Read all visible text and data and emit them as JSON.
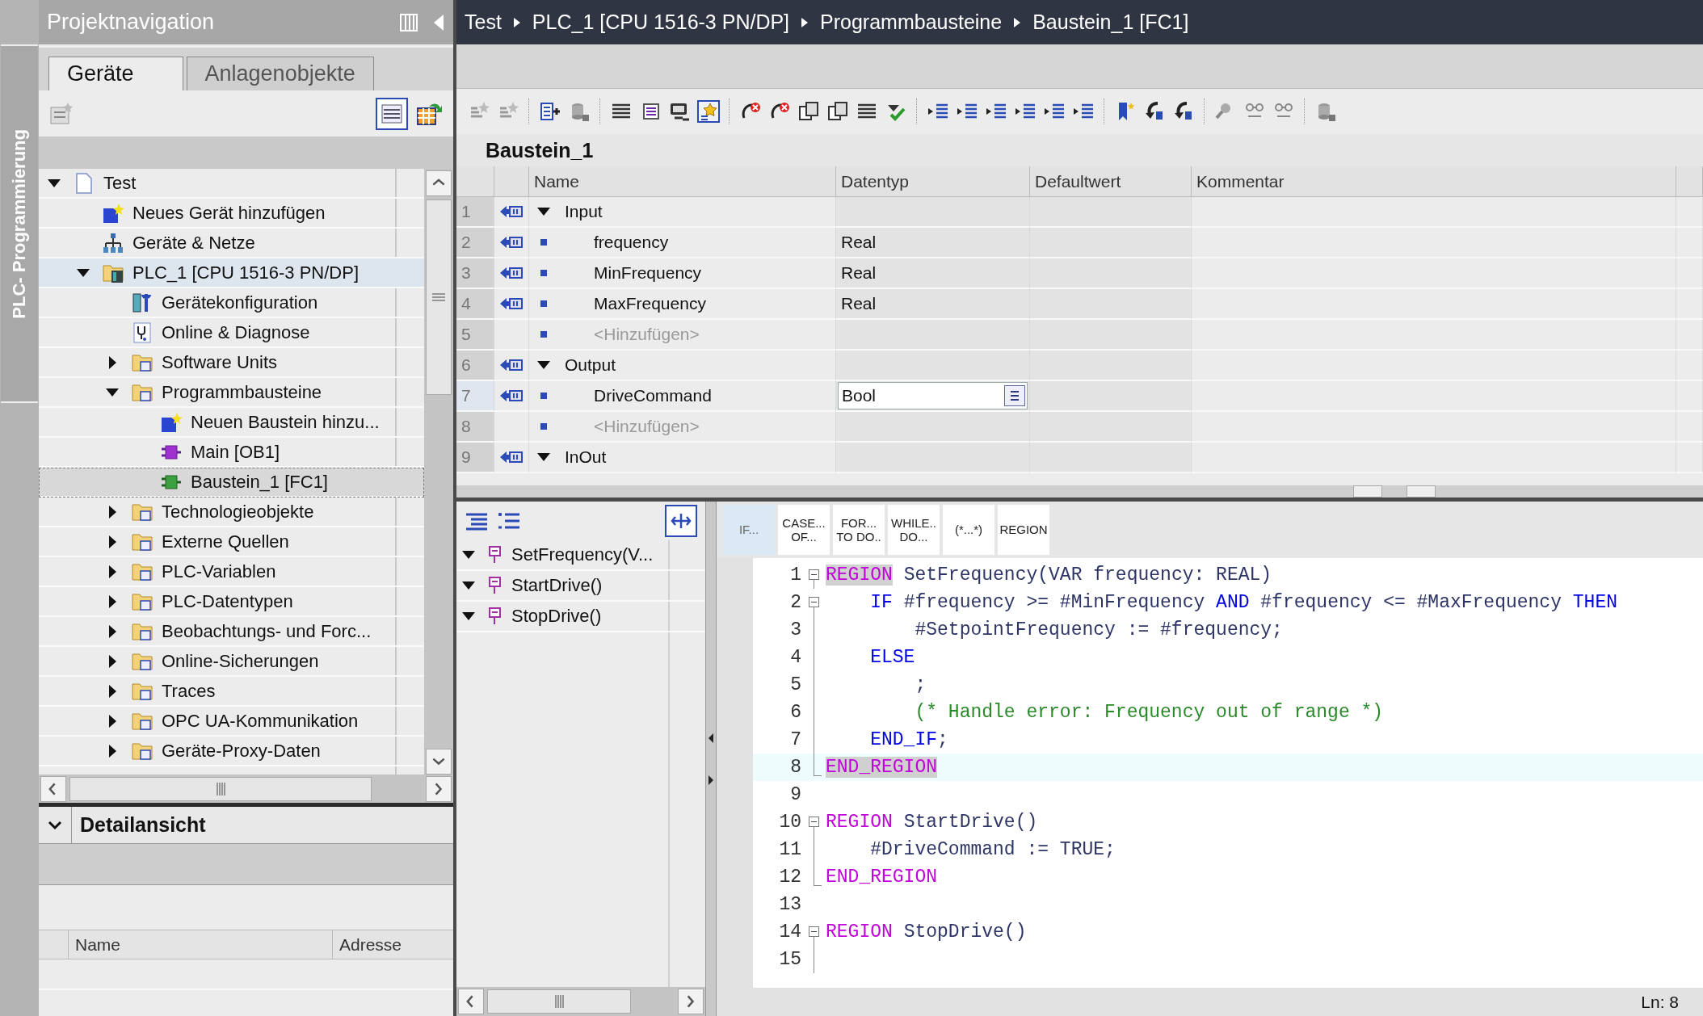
{
  "side_tab": {
    "label": "PLC- Programmierung"
  },
  "project_navigation": {
    "title": "Projektnavigation",
    "tabs": [
      {
        "label": "Geräte",
        "selected": true
      },
      {
        "label": "Anlagenobjekte",
        "selected": false
      }
    ],
    "tree": [
      {
        "label": "Test",
        "kind": "project",
        "expanded": true,
        "selected": false,
        "highlighted": false,
        "children": [
          {
            "label": "Neues Gerät hinzufügen",
            "kind": "add",
            "selected": false,
            "highlighted": false
          },
          {
            "label": "Geräte & Netze",
            "kind": "network",
            "selected": false,
            "highlighted": false
          },
          {
            "label": "PLC_1 [CPU 1516-3 PN/DP]",
            "kind": "plc",
            "expanded": true,
            "selected": false,
            "highlighted": true,
            "children": [
              {
                "label": "Gerätekonfiguration",
                "kind": "config",
                "selected": false,
                "highlighted": false
              },
              {
                "label": "Online & Diagnose",
                "kind": "diagnose",
                "selected": false,
                "highlighted": false
              },
              {
                "label": "Software Units",
                "kind": "folder",
                "expanded": false,
                "selected": false,
                "highlighted": false
              },
              {
                "label": "Programmbausteine",
                "kind": "folder",
                "expanded": true,
                "selected": false,
                "highlighted": false,
                "children": [
                  {
                    "label": "Neuen Baustein hinzu...",
                    "kind": "add",
                    "selected": false,
                    "highlighted": false
                  },
                  {
                    "label": "Main [OB1]",
                    "kind": "block-ob",
                    "selected": false,
                    "highlighted": false
                  },
                  {
                    "label": "Baustein_1 [FC1]",
                    "kind": "block-fc",
                    "selected": true,
                    "highlighted": false
                  }
                ]
              },
              {
                "label": "Technologieobjekte",
                "kind": "folder",
                "expanded": false,
                "selected": false,
                "highlighted": false
              },
              {
                "label": "Externe Quellen",
                "kind": "folder",
                "expanded": false,
                "selected": false,
                "highlighted": false
              },
              {
                "label": "PLC-Variablen",
                "kind": "folder",
                "expanded": false,
                "selected": false,
                "highlighted": false
              },
              {
                "label": "PLC-Datentypen",
                "kind": "folder",
                "expanded": false,
                "selected": false,
                "highlighted": false
              },
              {
                "label": "Beobachtungs- und Forc...",
                "kind": "folder",
                "expanded": false,
                "selected": false,
                "highlighted": false
              },
              {
                "label": "Online-Sicherungen",
                "kind": "folder",
                "expanded": false,
                "selected": false,
                "highlighted": false
              },
              {
                "label": "Traces",
                "kind": "folder",
                "expanded": false,
                "selected": false,
                "highlighted": false
              },
              {
                "label": "OPC UA-Kommunikation",
                "kind": "folder",
                "expanded": false,
                "selected": false,
                "highlighted": false
              },
              {
                "label": "Geräte-Proxy-Daten",
                "kind": "folder",
                "expanded": false,
                "selected": false,
                "highlighted": false
              }
            ]
          }
        ]
      }
    ]
  },
  "detail_view": {
    "title": "Detailansicht",
    "expanded": true,
    "columns": [
      "Name",
      "Adresse"
    ]
  },
  "breadcrumb": [
    "Test",
    "PLC_1 [CPU 1516-3 PN/DP]",
    "Programmbausteine",
    "Baustein_1 [FC1]"
  ],
  "block_interface": {
    "title": "Baustein_1",
    "columns": [
      "Name",
      "Datentyp",
      "Defaultwert",
      "Kommentar"
    ],
    "rows": [
      {
        "number": "1",
        "kind": "section",
        "name": "Input",
        "expanded": true,
        "selected": false
      },
      {
        "number": "2",
        "kind": "param",
        "name": "frequency",
        "datatype": "Real",
        "selected": false
      },
      {
        "number": "3",
        "kind": "param",
        "name": "MinFrequency",
        "datatype": "Real",
        "selected": false
      },
      {
        "number": "4",
        "kind": "param",
        "name": "MaxFrequency",
        "datatype": "Real",
        "selected": false
      },
      {
        "number": "5",
        "kind": "add",
        "name": "<Hinzufügen>",
        "selected": false
      },
      {
        "number": "6",
        "kind": "section",
        "name": "Output",
        "expanded": true,
        "selected": false
      },
      {
        "number": "7",
        "kind": "param",
        "name": "DriveCommand",
        "datatype": "Bool",
        "selected": true
      },
      {
        "number": "8",
        "kind": "add",
        "name": "<Hinzufügen>",
        "selected": false
      },
      {
        "number": "9",
        "kind": "section",
        "name": "InOut",
        "expanded": true,
        "selected": false
      }
    ]
  },
  "outline": {
    "items": [
      {
        "label": "SetFrequency(V...",
        "expanded": true
      },
      {
        "label": "StartDrive()",
        "expanded": true
      },
      {
        "label": "StopDrive()",
        "expanded": true
      }
    ]
  },
  "editor": {
    "snippets": [
      {
        "label": "IF...",
        "selected": true
      },
      {
        "label": "CASE...\nOF...",
        "selected": false
      },
      {
        "label": "FOR...\nTO DO..",
        "selected": false
      },
      {
        "label": "WHILE..\nDO...",
        "selected": false
      },
      {
        "label": "(*...*)",
        "selected": false
      },
      {
        "label": "REGION",
        "selected": false
      }
    ],
    "lines": [
      {
        "number": "1",
        "kind": "fold-start",
        "current": false,
        "tokens": [
          {
            "kind": "region",
            "text": "REGION",
            "matched": true
          },
          {
            "kind": "plain",
            "text": " SetFrequency(VAR frequency: REAL)"
          }
        ]
      },
      {
        "number": "2",
        "kind": "fold-start",
        "current": false,
        "tokens": [
          {
            "kind": "keyword",
            "text": "    IF"
          },
          {
            "kind": "plain",
            "text": " #frequency >= #MinFrequency "
          },
          {
            "kind": "keyword",
            "text": "AND"
          },
          {
            "kind": "plain",
            "text": " #frequency <= #MaxFrequency "
          },
          {
            "kind": "keyword",
            "text": "THEN"
          }
        ]
      },
      {
        "number": "3",
        "kind": "fold-inner",
        "current": false,
        "tokens": [
          {
            "kind": "plain",
            "text": "        #SetpointFrequency := #frequency;"
          }
        ]
      },
      {
        "number": "4",
        "kind": "fold-inner",
        "current": false,
        "tokens": [
          {
            "kind": "keyword",
            "text": "    ELSE"
          }
        ]
      },
      {
        "number": "5",
        "kind": "fold-inner",
        "current": false,
        "tokens": [
          {
            "kind": "plain",
            "text": "        ;"
          }
        ]
      },
      {
        "number": "6",
        "kind": "fold-inner",
        "current": false,
        "tokens": [
          {
            "kind": "comment",
            "text": "        (* Handle error: Frequency out of range *)"
          }
        ]
      },
      {
        "number": "7",
        "kind": "fold-inner",
        "current": false,
        "tokens": [
          {
            "kind": "keyword",
            "text": "    END_IF"
          },
          {
            "kind": "plain",
            "text": ";"
          }
        ]
      },
      {
        "number": "8",
        "kind": "fold-end",
        "current": true,
        "tokens": [
          {
            "kind": "region",
            "text": "END_REGION",
            "matched": true
          }
        ]
      },
      {
        "number": "9",
        "kind": "plain",
        "current": false
      },
      {
        "number": "10",
        "kind": "fold-start",
        "current": false,
        "tokens": [
          {
            "kind": "region",
            "text": "REGION",
            "matched": false
          },
          {
            "kind": "plain",
            "text": " StartDrive()"
          }
        ]
      },
      {
        "number": "11",
        "kind": "fold-inner",
        "current": false,
        "tokens": [
          {
            "kind": "plain",
            "text": "    #DriveCommand := TRUE;"
          }
        ]
      },
      {
        "number": "12",
        "kind": "fold-end",
        "current": false,
        "tokens": [
          {
            "kind": "region",
            "text": "END_REGION",
            "matched": false
          }
        ]
      },
      {
        "number": "13",
        "kind": "plain",
        "current": false
      },
      {
        "number": "14",
        "kind": "fold-start",
        "current": false,
        "tokens": [
          {
            "kind": "region",
            "text": "REGION",
            "matched": false
          },
          {
            "kind": "plain",
            "text": " StopDrive()"
          }
        ]
      },
      {
        "number": "15",
        "kind": "fold-inner",
        "current": false
      }
    ]
  },
  "status_bar": {
    "position": "Ln: 8"
  }
}
